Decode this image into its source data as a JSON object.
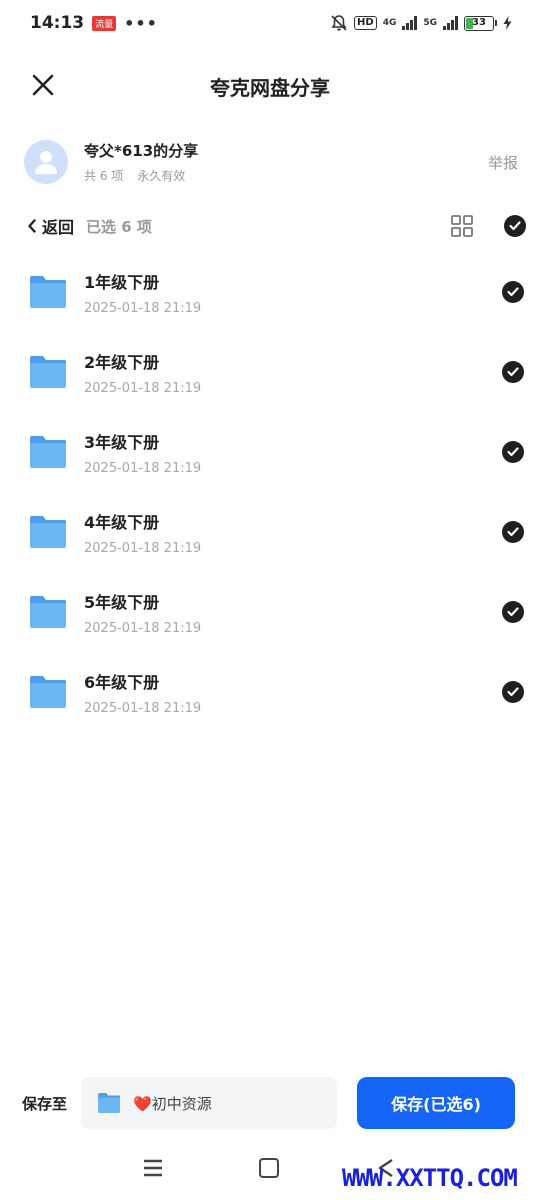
{
  "status_bar": {
    "time": "14:13",
    "badge": "流量",
    "dots": "•••",
    "hd": "HD",
    "net1": "4G",
    "net2": "5G",
    "battery": "33",
    "battery_level": 0.33
  },
  "header": {
    "title": "夸克网盘分享"
  },
  "share": {
    "owner": "夸父*613的分享",
    "count": "共 6 项",
    "validity": "永久有效",
    "report_label": "举报"
  },
  "selection": {
    "back_label": "返回",
    "selected_text": "已选 6 项"
  },
  "files": [
    {
      "name": "1年级下册",
      "date": "2025-01-18 21:19"
    },
    {
      "name": "2年级下册",
      "date": "2025-01-18 21:19"
    },
    {
      "name": "3年级下册",
      "date": "2025-01-18 21:19"
    },
    {
      "name": "4年级下册",
      "date": "2025-01-18 21:19"
    },
    {
      "name": "5年级下册",
      "date": "2025-01-18 21:19"
    },
    {
      "name": "6年级下册",
      "date": "2025-01-18 21:19"
    }
  ],
  "bottom": {
    "save_to_label": "保存至",
    "target_folder": "❤️初中资源",
    "save_button": "保存(已选6)"
  },
  "watermark": "WWW.XXTTQ.COM",
  "colors": {
    "primary": "#1465f5",
    "folder": "#5aaef0",
    "check": "#1f1f1f",
    "muted": "#999999"
  }
}
